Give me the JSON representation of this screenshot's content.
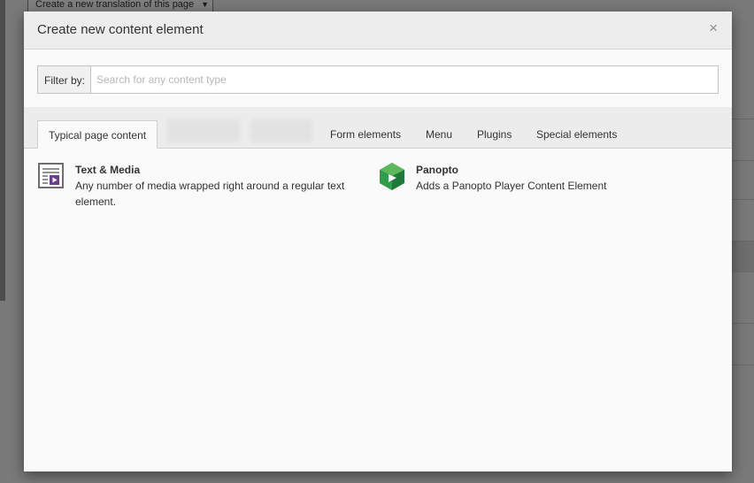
{
  "background": {
    "translation_select": "Create a new translation of this page"
  },
  "modal": {
    "title": "Create new content element",
    "close_label": "×",
    "filter": {
      "label": "Filter by:",
      "placeholder": "Search for any content type",
      "value": ""
    },
    "tabs": [
      {
        "label": "Typical page content",
        "active": true
      },
      {
        "label": "Form elements",
        "active": false
      },
      {
        "label": "Menu",
        "active": false
      },
      {
        "label": "Plugins",
        "active": false
      },
      {
        "label": "Special elements",
        "active": false
      }
    ],
    "items": [
      {
        "title": "Text & Media",
        "description": "Any number of media wrapped right around a regular text element.",
        "icon": "text-media-icon"
      },
      {
        "title": "Panopto",
        "description": "Adds a Panopto Player Content Element",
        "icon": "panopto-logo-icon"
      }
    ]
  },
  "colors": {
    "panopto_green_dark": "#1e7a3a",
    "panopto_green_light": "#5cb85c",
    "media_purple": "#6a3f8f"
  }
}
